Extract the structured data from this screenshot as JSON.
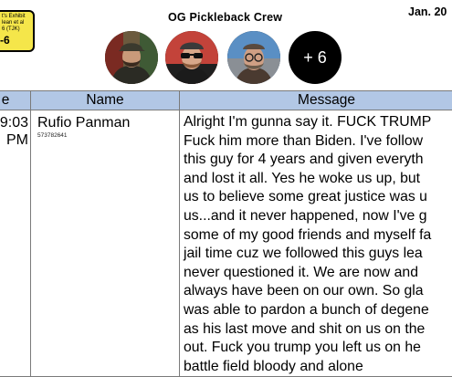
{
  "exhibit": {
    "line1": "t's Exhibit",
    "line2": "lean et al",
    "line3": "6 (TJK)",
    "number": "-6"
  },
  "header": {
    "title": "OG Pickleback Crew",
    "date": "Jan. 20"
  },
  "avatars": {
    "more_label": "+ 6"
  },
  "table": {
    "headers": {
      "time": "e",
      "name": "Name",
      "message": "Message"
    },
    "rows": [
      {
        "time_line1": "9:03",
        "time_line2": "PM",
        "name": "Rufio Panman",
        "phone": "573782641",
        "message_lines": [
          "Alright I'm gunna say it.  FUCK TRUMP",
          "Fuck him more than Biden.  I've follow",
          "this guy for 4 years and given everyth",
          "and lost it all. Yes he woke us up, but",
          "us to believe some great justice was u",
          "us...and it never happened, now I've g",
          "some of my good friends and myself fa",
          "jail time cuz we followed this guys lea",
          "never questioned it.  We are now and",
          "always have been on our own.  So gla",
          "was able to pardon a bunch of degene",
          "as his last move and shit on us on the",
          "out.  Fuck you trump you left us on he",
          "battle field bloody and alone"
        ]
      }
    ]
  },
  "colors": {
    "header_bg": "#b2c7e5",
    "exhibit_bg": "#f5e64a"
  }
}
